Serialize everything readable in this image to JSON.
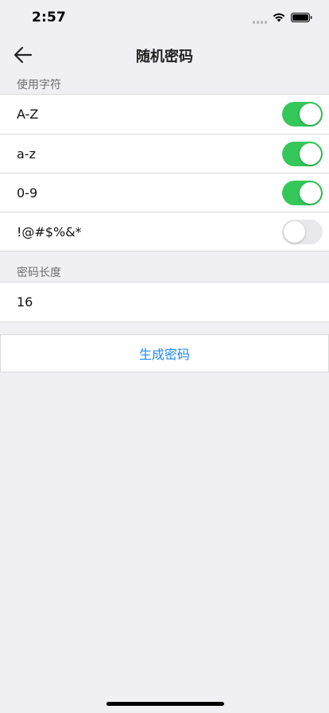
{
  "status_bar": {
    "time": "2:57",
    "icons": [
      "signal-icon",
      "wifi-icon",
      "battery-icon"
    ]
  },
  "nav": {
    "back_icon": "arrow-left-icon",
    "title": "随机密码"
  },
  "charset_section": {
    "header": "使用字符",
    "options": [
      {
        "label": "A-Z",
        "enabled": true
      },
      {
        "label": "a-z",
        "enabled": true
      },
      {
        "label": "0-9",
        "enabled": true
      },
      {
        "label": "!@#$%&*",
        "enabled": false
      }
    ]
  },
  "length_section": {
    "header": "密码长度",
    "value": "16"
  },
  "actions": {
    "generate_label": "生成密码"
  },
  "colors": {
    "toggle_on": "#34c759",
    "toggle_off": "#e9e9eb",
    "link_blue": "#1e88f0",
    "background": "#efeff4"
  }
}
